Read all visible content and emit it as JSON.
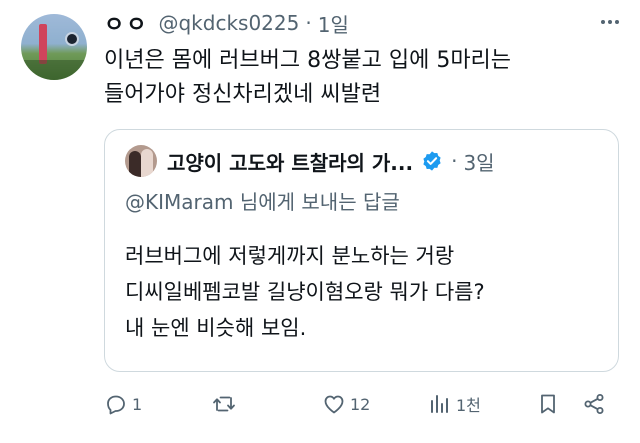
{
  "tweet": {
    "author_name": "ㅇㅇ",
    "handle": "@qkdcks0225",
    "separator": "·",
    "time": "1일",
    "text_lines": [
      "이년은 몸에 러브버그 8쌍붙고 입에 5마리는",
      "들어가야 정신차리겠네 씨발련"
    ]
  },
  "quote": {
    "author_name": "고양이 고도와 트찰라의 가...",
    "separator": "·",
    "time": "3일",
    "reply_to": "@KIMaram 님에게 보내는 답글",
    "text_lines": [
      "러브버그에 저렇게까지 분노하는 거랑",
      "디씨일베펨코발 길냥이혐오랑 뭐가 다름?",
      "내 눈엔 비슷해 보임."
    ]
  },
  "actions": {
    "reply_count": "1",
    "retweet_count": "",
    "like_count": "12",
    "view_count": "1천"
  },
  "colors": {
    "text": "#0f1419",
    "secondary": "#536471",
    "border": "#cfd9de",
    "verified": "#1d9bf0"
  },
  "icons": [
    "more-icon",
    "verified-icon",
    "reply-icon",
    "retweet-icon",
    "like-icon",
    "views-icon",
    "bookmark-icon",
    "share-icon"
  ]
}
